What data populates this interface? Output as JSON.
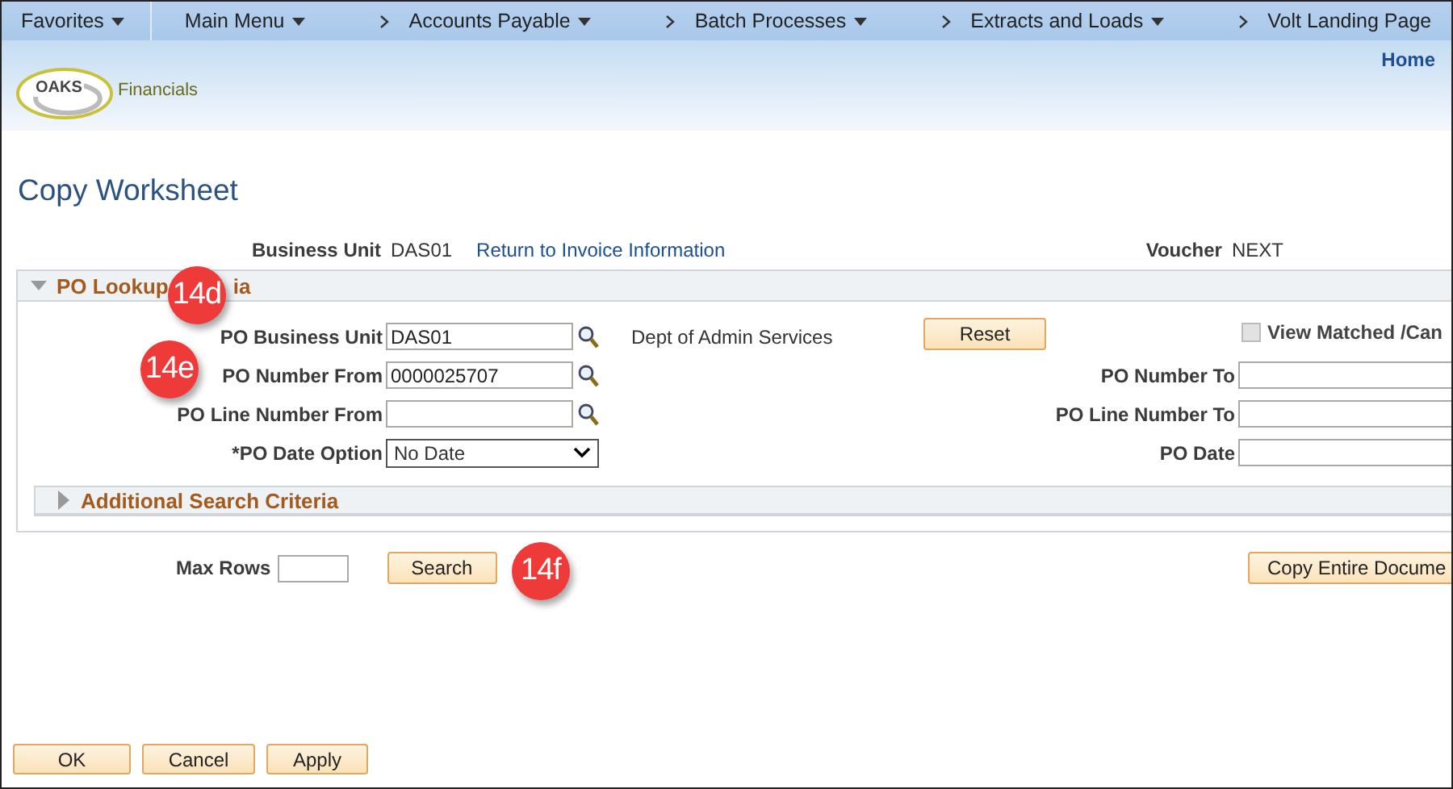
{
  "nav": {
    "items": [
      {
        "label": "Favorites",
        "kind": "menu"
      },
      {
        "label": "Main Menu",
        "kind": "menu"
      },
      {
        "label": "Accounts Payable",
        "kind": "menu"
      },
      {
        "label": "Batch Processes",
        "kind": "menu"
      },
      {
        "label": "Extracts and Loads",
        "kind": "menu"
      },
      {
        "label": "Volt Landing Page",
        "kind": "link"
      }
    ]
  },
  "header": {
    "logo_mark": "OAKS",
    "logo_name": "Financials",
    "home_link": "Home"
  },
  "page_title": "Copy Worksheet",
  "context": {
    "business_unit_label": "Business Unit",
    "business_unit_value": "DAS01",
    "return_link": "Return to Invoice Information",
    "voucher_label": "Voucher",
    "voucher_value": "NEXT"
  },
  "lookup_section": {
    "title_parts": [
      "PO Lookup",
      "ia"
    ],
    "expanded": true,
    "left_fields": [
      {
        "label": "PO Business Unit",
        "value": "DAS01",
        "kind": "lookup",
        "description": "Dept of Admin Services"
      },
      {
        "label": "PO Number From",
        "value": "0000025707",
        "kind": "lookup"
      },
      {
        "label": "PO Line Number From",
        "kind": "lookup"
      },
      {
        "label": "*PO Date Option",
        "value": "No Date",
        "kind": "select"
      }
    ],
    "reset_button": "Reset",
    "right_fields": [
      {
        "kind": "checkbox",
        "label": "View Matched /Can",
        "checked": false,
        "disabled": true
      },
      {
        "kind": "text",
        "label": "PO Number To"
      },
      {
        "kind": "text",
        "label": "PO Line Number To"
      },
      {
        "kind": "text",
        "label": "PO Date"
      }
    ],
    "additional_section": {
      "title": "Additional Search Criteria",
      "expanded": false
    }
  },
  "max_rows": {
    "label": "Max Rows"
  },
  "search_button": "Search",
  "copy_button": "Copy Entire Docume",
  "footer_buttons": [
    "OK",
    "Cancel",
    "Apply"
  ],
  "callouts": [
    {
      "label": "14d"
    },
    {
      "label": "14e"
    },
    {
      "label": "14f"
    }
  ]
}
